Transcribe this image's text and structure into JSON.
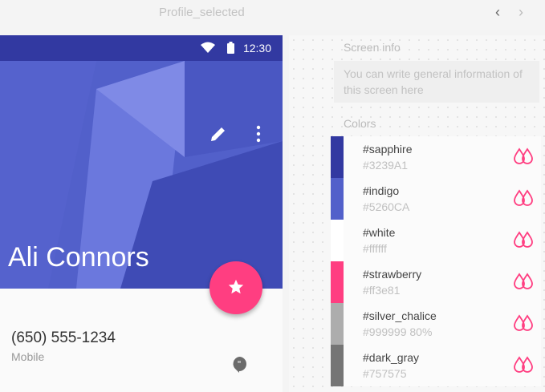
{
  "window": {
    "title": "Profile_selected",
    "back_icon": "chevron-left-icon",
    "forward_icon": "chevron-right-icon"
  },
  "phone": {
    "status_time": "12:30",
    "profile_name": "Ali Connors",
    "phone_number": "(650) 555-1234",
    "phone_type": "Mobile"
  },
  "panel": {
    "screen_info_title": "Screen info",
    "screen_info_text": "You can write general information of this screen here",
    "colors_title": "Colors",
    "colors": [
      {
        "name": "#sapphire",
        "hex": "#3239A1",
        "swatch": "#3239A1"
      },
      {
        "name": "#indigo",
        "hex": "#5260CA",
        "swatch": "#5260CA"
      },
      {
        "name": "#white",
        "hex": "#ffffff",
        "swatch": "#ffffff"
      },
      {
        "name": "#strawberry",
        "hex": "#ff3e81",
        "swatch": "#ff3e81"
      },
      {
        "name": "#silver_chalice",
        "hex": "#999999  80%",
        "swatch": "#adadad"
      },
      {
        "name": "#dark_gray",
        "hex": "#757575",
        "swatch": "#757575"
      }
    ]
  },
  "colors": {
    "accent": "#ff3e81",
    "primary_dark": "#3239A1",
    "primary": "#5260CA"
  }
}
